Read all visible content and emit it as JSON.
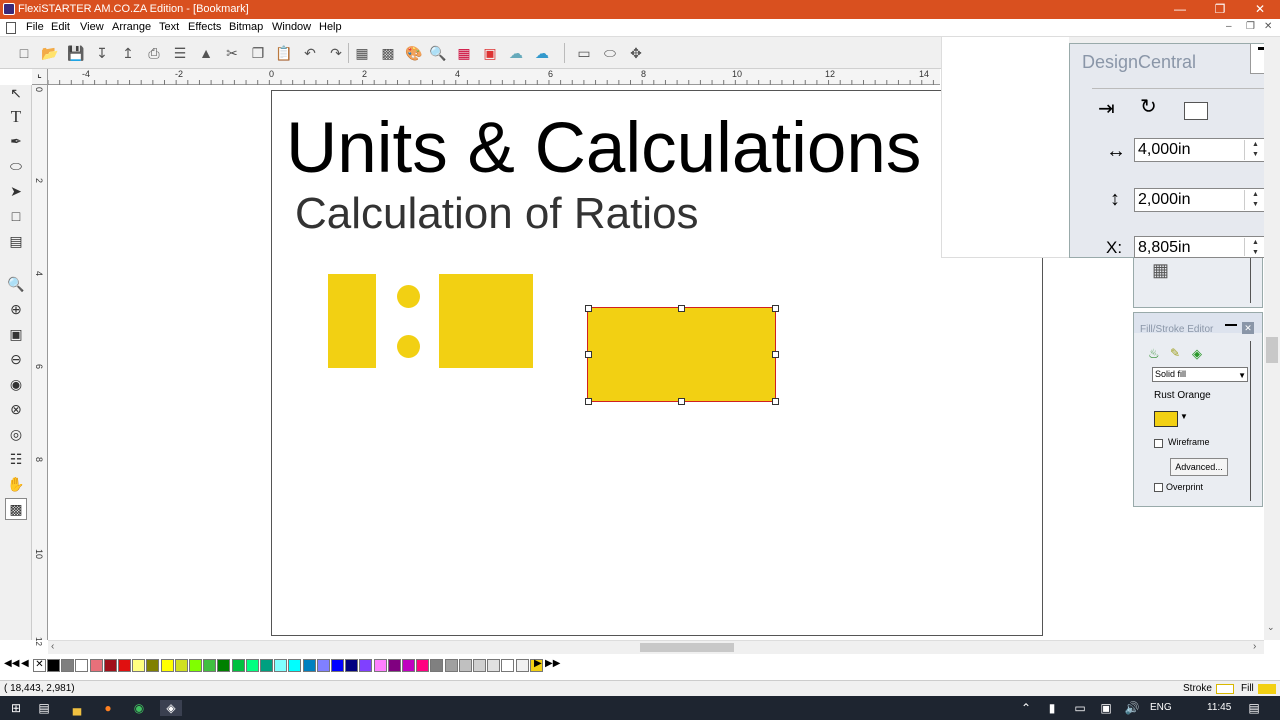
{
  "window": {
    "title": "FlexiSTARTER AM.CO.ZA Edition - [Bookmark]"
  },
  "menu": [
    "File",
    "Edit",
    "View",
    "Arrange",
    "Text",
    "Effects",
    "Bitmap",
    "Window",
    "Help"
  ],
  "canvas": {
    "heading": "Units & Calculations",
    "subheading": "Calculation of Ratios",
    "shape_color": "#f2d013"
  },
  "ruler": {
    "h_labels": [
      "-4",
      "-2",
      "0",
      "2",
      "4",
      "6",
      "8",
      "10",
      "12",
      "14"
    ],
    "v_labels": [
      "0",
      "2",
      "4",
      "6",
      "8",
      "10",
      "12"
    ]
  },
  "design_central": {
    "title": "DesignCentral",
    "width_value": "4,000in",
    "height_value": "2,000in",
    "x_label": "X:",
    "x_value": "8,805in"
  },
  "fill_stroke": {
    "title": "Fill/Stroke Editor",
    "fill_type": "Solid fill",
    "color_name": "Rust Orange",
    "swatch_color": "#f2d013",
    "wireframe_label": "Wireframe",
    "advanced_label": "Advanced...",
    "overprint_label": "Overprint"
  },
  "palette": [
    "#000000",
    "#7f7f7f",
    "#ffffff",
    "#e8707a",
    "#a0101a",
    "#e01010",
    "#ffff80",
    "#808000",
    "#ffff00",
    "#d0e020",
    "#80ff00",
    "#40c040",
    "#008000",
    "#00c040",
    "#00ff80",
    "#00a080",
    "#80ffff",
    "#00ffff",
    "#0080c0",
    "#8080ff",
    "#0000ff",
    "#000080",
    "#8040ff",
    "#ff80ff",
    "#800080",
    "#c000c0",
    "#ff0080",
    "#808080",
    "#a0a0a0",
    "#c0c0c0",
    "#d0d0d0",
    "#e0e0e0",
    "#ffffff",
    "#f0f0f0",
    "#f2d013"
  ],
  "status": {
    "coords": "( 18,443,    2,981)",
    "stroke_label": "Stroke",
    "fill_label": "Fill"
  },
  "taskbar": {
    "lang": "ENG",
    "time": "11:45"
  }
}
